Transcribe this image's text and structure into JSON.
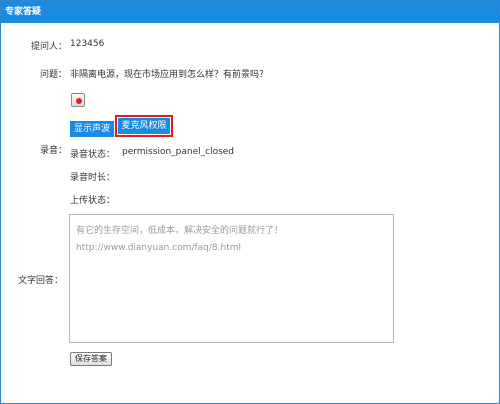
{
  "dialog": {
    "title": "专家答疑"
  },
  "questioner": {
    "label": "提问人：",
    "value": "123456"
  },
  "question": {
    "label": "问题：",
    "value": "非隔离电源，现在市场应用到怎么样？有前景吗？"
  },
  "recording": {
    "label": "录音：",
    "show_waveform_label": "显示声波",
    "mic_permission_label": "麦克风权限",
    "status_label": "录音状态：",
    "status_value": "permission_panel_closed",
    "duration_label": "录音时长：",
    "upload_label": "上传状态："
  },
  "text_answer": {
    "label": "文字回答：",
    "placeholder_line1": "有它的生存空间，低成本，解决安全的问题就行了！",
    "placeholder_line2": "http://www.dianyuan.com/faq/8.html"
  },
  "save_label": "保存答案",
  "colors": {
    "title_bar": "#1a8be0",
    "button_blue": "#1a8be0",
    "highlight": "#e02020"
  }
}
